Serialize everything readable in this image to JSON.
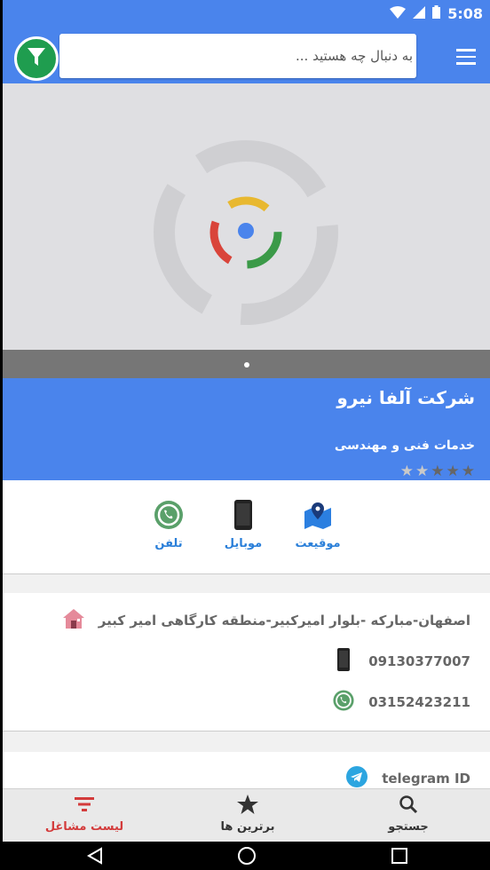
{
  "status_bar": {
    "time": "5:08"
  },
  "search": {
    "placeholder": "به دنبال چه هستید ..."
  },
  "business": {
    "name": "شرکت آلفا نیرو",
    "category": "خدمات فنی و مهندسی",
    "rating": 3,
    "rating_max": 5
  },
  "contact_actions": {
    "location": "موقیعت",
    "mobile": "موبایل",
    "phone": "تلفن"
  },
  "details": {
    "address": "اصفهان-مبارکه -بلوار امیرکبیر-منطقه کارگاهی امیر کبیر",
    "mobile": "09130377007",
    "phone": "03152423211",
    "telegram": "telegram ID"
  },
  "bottom_nav": {
    "search": "جستجو",
    "top": "برترین ها",
    "jobs": "لیست مشاغل"
  },
  "colors": {
    "primary": "#4a84ec",
    "accent_green": "#1f9d4f",
    "active_red": "#d33b3b",
    "link_blue": "#2a7fd9"
  }
}
